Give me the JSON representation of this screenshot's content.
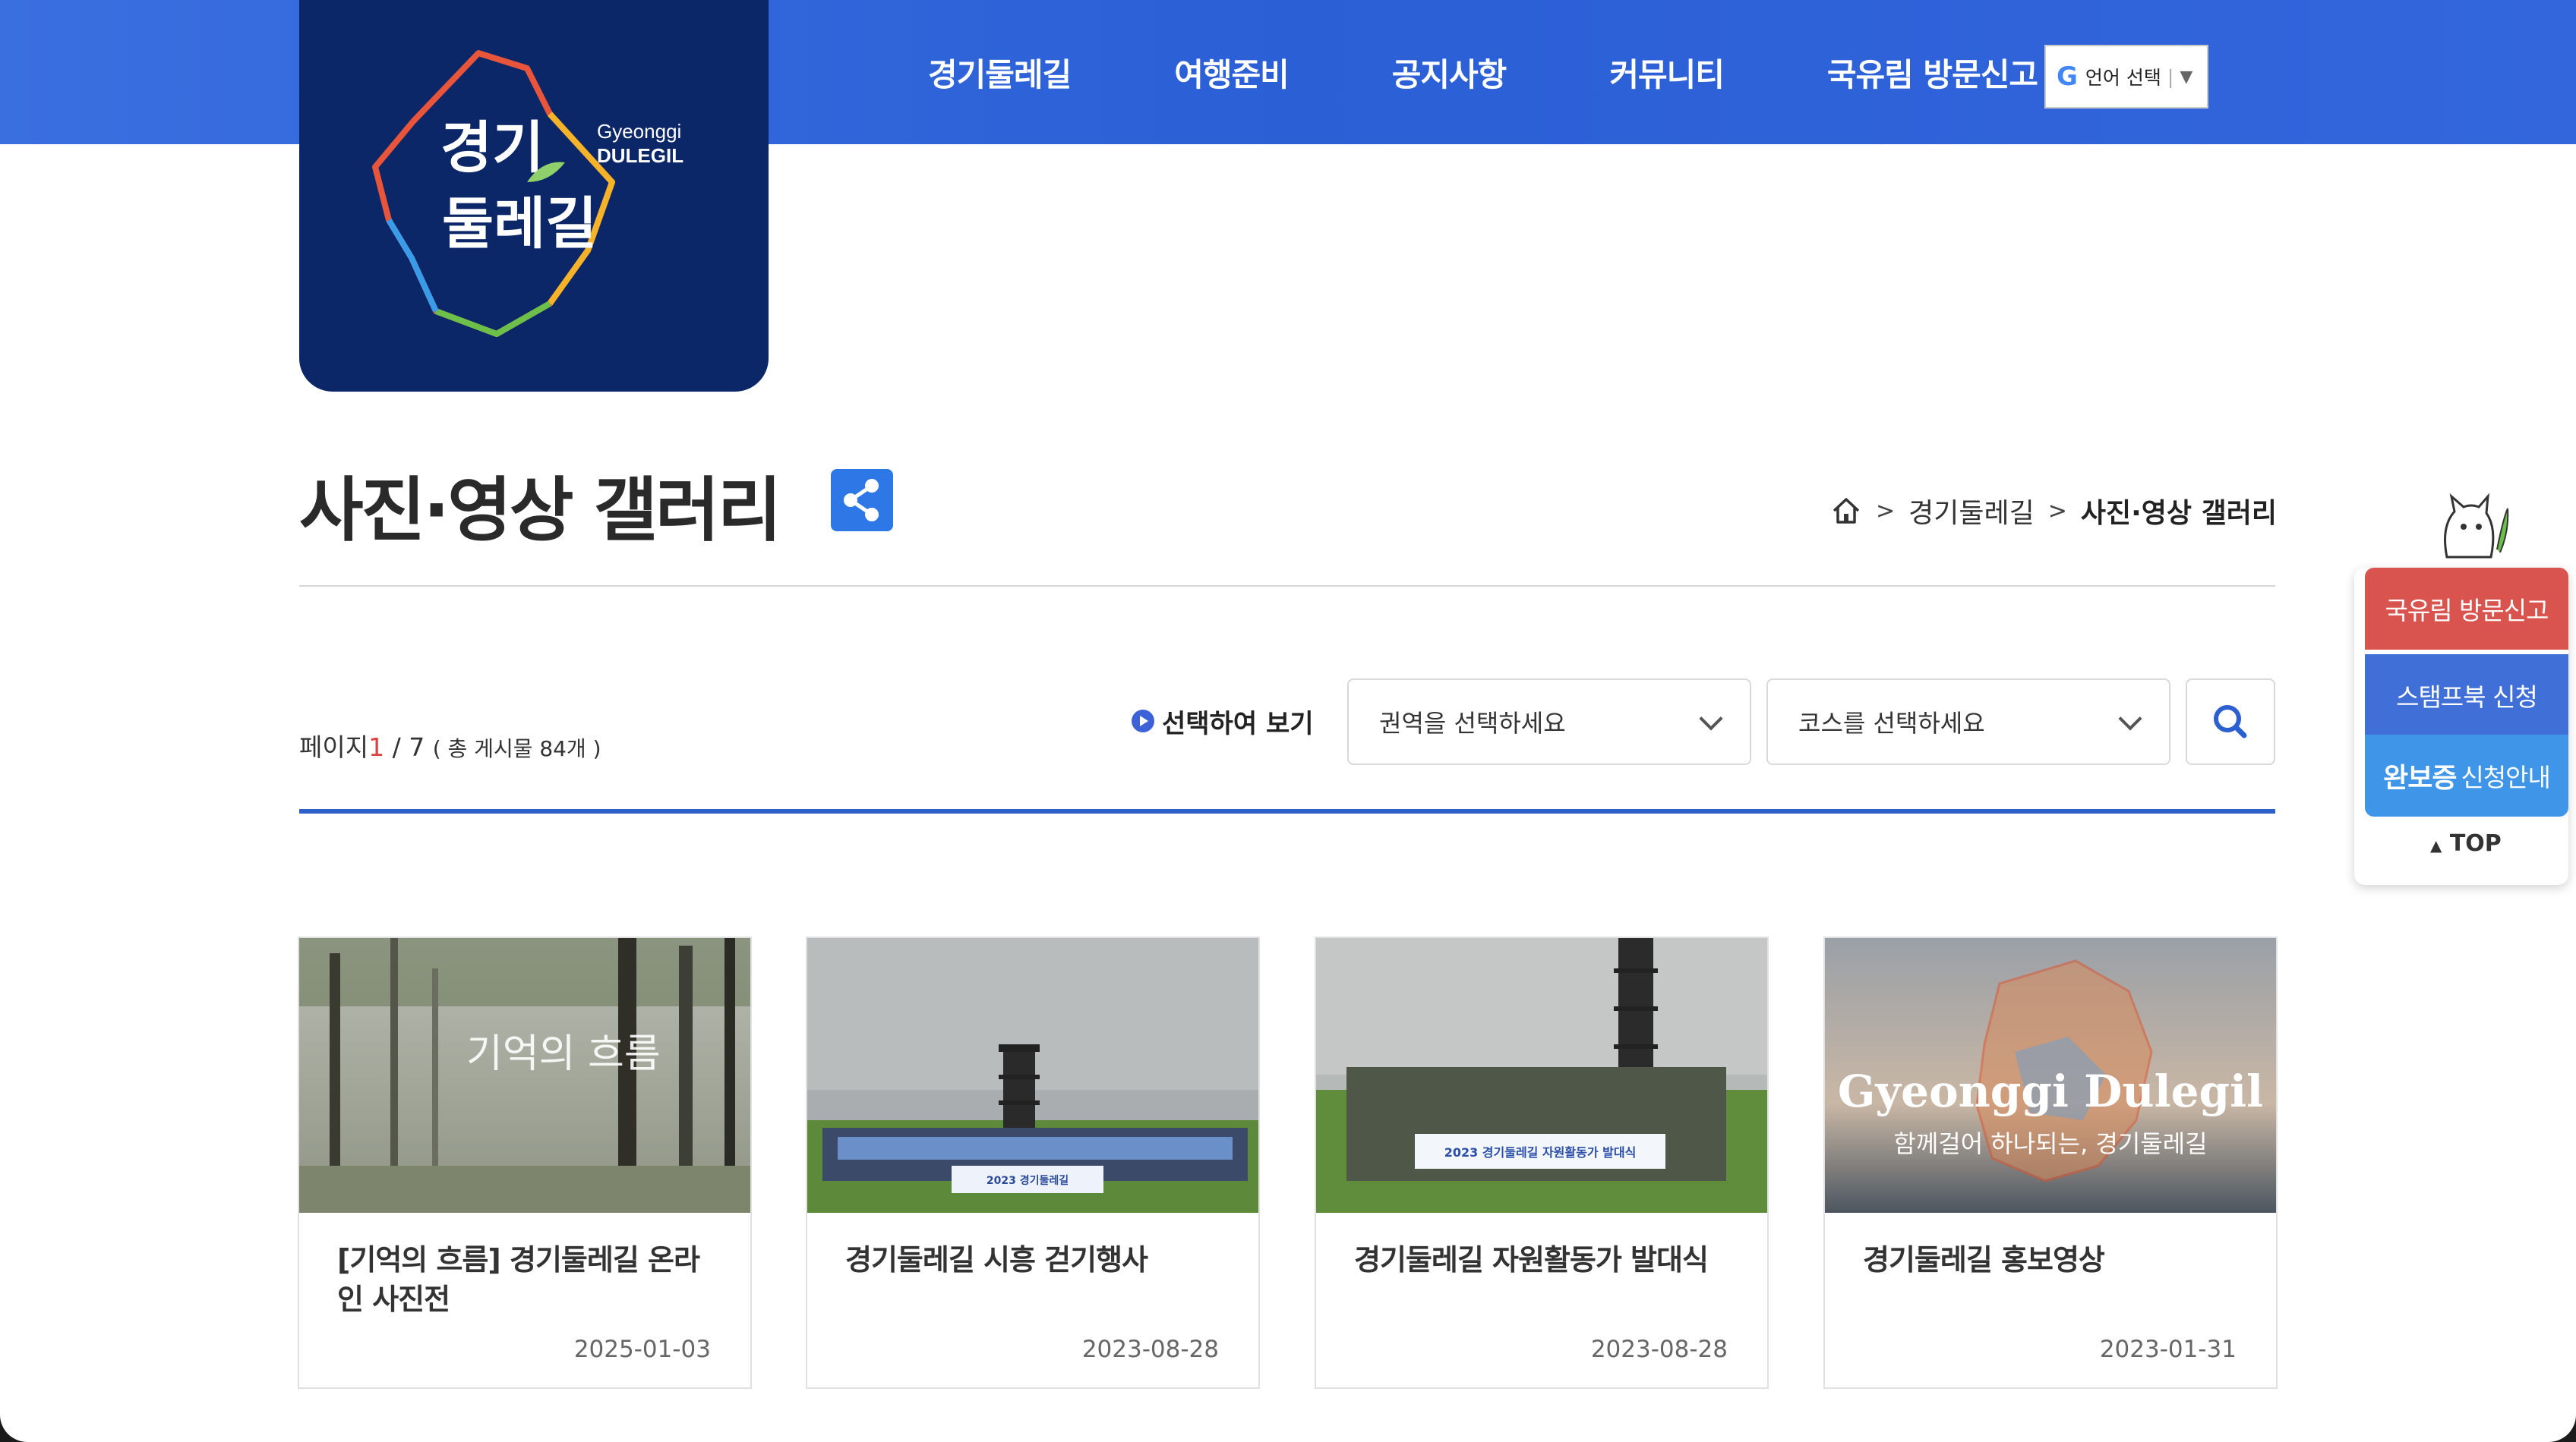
{
  "header": {
    "logo_kr": [
      "경기",
      "둘레길"
    ],
    "logo_en": [
      "Gyeonggi",
      "DULEGIL"
    ],
    "nav": [
      "경기둘레길",
      "여행준비",
      "공지사항",
      "커뮤니티",
      "국유림 방문신고"
    ],
    "language": {
      "label": "언어 선택",
      "arrow": "▼"
    }
  },
  "title": {
    "text": "사진·영상 갤러리",
    "share_icon": "share-icon"
  },
  "breadcrumb": {
    "home_icon": "home-icon",
    "separator": ">",
    "items": [
      "경기둘레길",
      "사진·영상 갤러리"
    ]
  },
  "filter": {
    "page_label": "페이지",
    "current_page": "1",
    "total_pages": "/ 7",
    "total_posts": "( 총 게시물 84개 )",
    "view_label": "선택하여 보기",
    "region_placeholder": "권역을 선택하세요",
    "course_placeholder": "코스를 선택하세요",
    "search_icon": "search-icon"
  },
  "gallery": [
    {
      "title": "[기억의 흐름] 경기둘레길 온라인 사진전",
      "date": "2025-01-03",
      "overlay": "기억의 흐름"
    },
    {
      "title": "경기둘레길 시흥 걷기행사",
      "date": "2023-08-28",
      "banner": "2023 경기둘레길"
    },
    {
      "title": "경기둘레길 자원활동가 발대식",
      "date": "2023-08-28",
      "banner": "2023 경기둘레길 자원활동가 발대식"
    },
    {
      "title": "경기둘레길 홍보영상",
      "date": "2023-01-31",
      "overlay_en": "Gyeonggi Dulegil",
      "overlay_kr": "함께걸어 하나되는, 경기둘레길"
    }
  ],
  "quick_menu": {
    "report": "국유림 방문신고",
    "stamp": "스탬프북 신청",
    "cert_bold": "완보증",
    "cert_rest": "신청안내",
    "top": "TOP",
    "top_arrow": "▲"
  },
  "colors": {
    "header_blue": "#2b5fd6",
    "logo_navy": "#0b2768",
    "accent_red": "#d9534f",
    "quick_blue": "#3f6fd7",
    "quick_light_blue": "#3f95e8",
    "divider_blue": "#2f5fc9"
  }
}
